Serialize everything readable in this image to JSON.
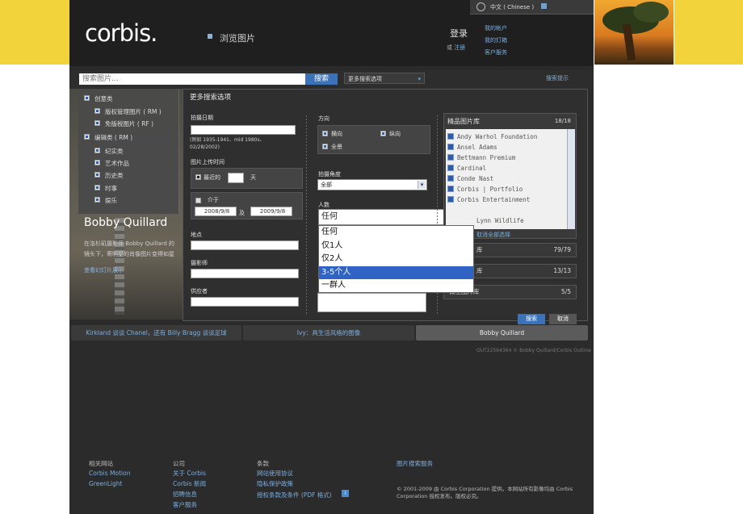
{
  "header": {
    "logo": "corbis.",
    "browse": "浏览图片",
    "language": "中文 ( Chinese )",
    "login": "登录",
    "or_label": "或",
    "register": "注册",
    "account_links": [
      "我的帐户",
      "我的灯箱",
      "客户服务"
    ]
  },
  "search": {
    "placeholder": "搜索图片...",
    "button": "搜索",
    "more_options": "更多搜索选项",
    "tips": "搜索提示"
  },
  "categories": [
    {
      "label": "创意类",
      "checked": true,
      "indent": false
    },
    {
      "label": "版权管理图片 ( RM )",
      "checked": true,
      "indent": true
    },
    {
      "label": "免版税图片 ( RF )",
      "checked": true,
      "indent": true
    },
    {
      "label": "编辑类 ( RM )",
      "checked": true,
      "indent": false
    },
    {
      "label": "纪实类",
      "checked": true,
      "indent": true
    },
    {
      "label": "艺术作品",
      "checked": true,
      "indent": true
    },
    {
      "label": "历史类",
      "checked": true,
      "indent": true
    },
    {
      "label": "时事",
      "checked": true,
      "indent": true
    },
    {
      "label": "娱乐",
      "checked": true,
      "indent": true
    }
  ],
  "hero": {
    "name": "Bobby Quillard",
    "desc": "在洛杉矶摄影师 Bobby Quillard 的镜头下，寄明星的肖像图片变得如星般闪亮。",
    "slideshow": "查看幻灯片展示"
  },
  "advanced": {
    "title": "更多搜索选项",
    "date_label": "拍摄日期",
    "date_example": "(例如 1935-1941、mid 1980s、02/28/2002)",
    "upload_label": "图片上传时间",
    "recent_label": "最近的",
    "days_label": "天",
    "between_label": "介于",
    "date_from": "2008/9/8",
    "and_label": "及",
    "date_to": "2009/9/8",
    "location_label": "地点",
    "photographer_label": "摄影师",
    "supplier_label": "供应者",
    "orientation_label": "方向",
    "orient_landscape": "横向",
    "orient_portrait": "纵向",
    "orient_panorama": "全景",
    "angle_label": "拍摄角度",
    "angle_value": "全部",
    "people_label": "人数",
    "people_value": "任何",
    "people_options": [
      "任何",
      "仅1人",
      "仅2人",
      "3-5个人",
      "一群人"
    ],
    "people_selected_index": 3
  },
  "libraries": {
    "title": "精品图片库",
    "count": "18/18",
    "items": [
      "Andy Warhol Foundation",
      "Ansel Adams",
      "Bettmann Premium",
      "Cardinal",
      "Conde Nast",
      "Corbis | Portfolio",
      "Corbis Entertainment"
    ],
    "extra_item": "Lynn Wildlife",
    "deselect_all": "取消全部选择",
    "rows": [
      {
        "label": "库",
        "count": "79/79"
      },
      {
        "label": "库",
        "count": "13/13"
      },
      {
        "label": "微型图片库",
        "count": "5/5"
      }
    ]
  },
  "actions": {
    "search": "搜索",
    "cancel": "取消"
  },
  "bottom_tabs": [
    {
      "label": "Kirkland 谈谈 Chanel，还有 Billy Bragg 谈谈足球",
      "active": false
    },
    {
      "label": "Ivy：具生活风格的图像",
      "active": false
    },
    {
      "label": "Bobby Quillard",
      "active": true
    }
  ],
  "credit": "OUT22564364 © Bobby Quillard/Corbis Outline",
  "footer": {
    "col1_title": "相关网站",
    "col1_links": [
      "Corbis Motion",
      "GreenLight"
    ],
    "col2_title": "公司",
    "col2_links": [
      "关于 Corbis",
      "Corbis 新闻",
      "招聘信息",
      "客户服务"
    ],
    "col3_title": "条款",
    "col3_links": [
      "网站使用协议",
      "隐私保护政策",
      "授权条款及条件 (PDF 格式)"
    ],
    "col4_link": "图片搜索服务",
    "copyright": "© 2001-2009 由 Corbis Corporation 提供。本网站所有影像均由 Corbis Corporation 授权发布。版权必究。"
  },
  "colors": {
    "accent_yellow": "#f2d33b",
    "link_blue": "#7aaee0",
    "button_blue": "#3c72b8",
    "selection_blue": "#3163c4"
  }
}
